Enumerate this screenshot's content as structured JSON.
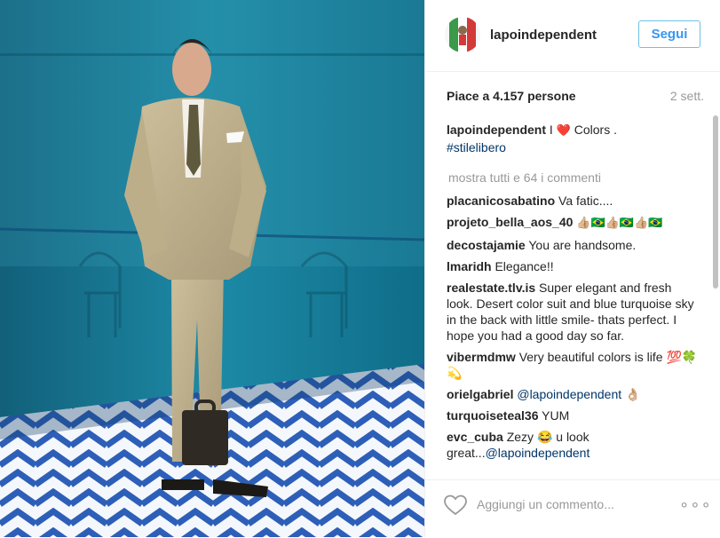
{
  "post": {
    "username": "lapoindependent",
    "follow_label": "Segui",
    "likes_text": "Piace a 4.157 persone",
    "age": "2 sett.",
    "caption": {
      "user": "lapoindependent",
      "text_before": " I ",
      "heart": "❤️",
      "text_after": " Colors .",
      "hashtag": "#stilelibero"
    },
    "view_all_comments": "mostra tutti e 64 i commenti",
    "comments": [
      {
        "user": "placanicosabatino",
        "text": "Va fatic...."
      },
      {
        "user": "projeto_bella_aos_40",
        "text": "👍🏼🇧🇷👍🏼🇧🇷👍🏼🇧🇷"
      },
      {
        "user": "decostajamie",
        "text": "You are handsome."
      },
      {
        "user": "lmaridh",
        "text": "Elegance!!"
      },
      {
        "user": "realestate.tlv.is",
        "text": "Super elegant and fresh look. Desert color suit and blue turquoise sky in the back with little smile- thats perfect. I hope you had a good day so far."
      },
      {
        "user": "vibermdmw",
        "text": "Very beautiful colors is life 💯🍀💫"
      },
      {
        "user": "orielgabriel",
        "mention": "@lapoindependent",
        "text": " 👌🏼"
      },
      {
        "user": "turquoiseteal36",
        "text": "YUM"
      },
      {
        "user": "evc_cuba",
        "text": "Zezy 😂 u look great...",
        "mention": "@lapoindependent"
      }
    ],
    "comment_placeholder": "Aggiungi un commento...",
    "more_label": "∘∘∘"
  },
  "colors": {
    "accent": "#3897f0",
    "follow_border": "#70c0e7",
    "text": "#262626",
    "muted": "#999999",
    "mention": "#003569",
    "divider": "#efefef"
  },
  "icons": {
    "like": "heart-outline-icon",
    "more": "more-options-icon"
  }
}
